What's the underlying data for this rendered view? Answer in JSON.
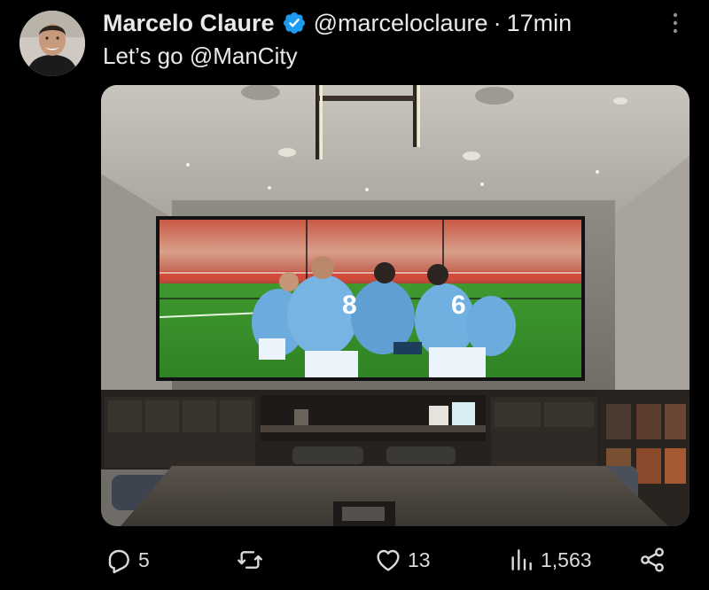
{
  "tweet": {
    "author_name": "Marcelo Claure",
    "handle": "@marceloclaure",
    "separator": "·",
    "time": "17min",
    "text_prefix": "Let’s go ",
    "text_mention": "@ManCity",
    "jersey_numbers": [
      "8",
      "6"
    ]
  },
  "icons": {
    "verified": "verified-badge-icon",
    "more": "more-vertical-icon",
    "reply": "reply-icon",
    "retweet": "retweet-icon",
    "like": "like-icon",
    "views": "views-icon",
    "share": "share-icon"
  },
  "actions": {
    "replies": "5",
    "retweets": "",
    "likes": "13",
    "views": "1,563"
  },
  "colors": {
    "background": "#000000",
    "text": "#e7e9ea",
    "verified": "#1d9bf0",
    "city_blue": "#6cabdd",
    "pitch_green": "#3e9a2c"
  }
}
